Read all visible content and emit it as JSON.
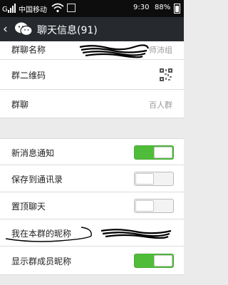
{
  "status_bar": {
    "carrier": "中国移动",
    "time": "9:30",
    "battery": "88%"
  },
  "header": {
    "title": "聊天信息(91)"
  },
  "settings": {
    "group_name": {
      "label": "群聊名称",
      "value": "师沛组"
    },
    "qr_code": {
      "label": "群二维码"
    },
    "group_chat": {
      "label": "群聊",
      "value": "百人群"
    },
    "new_msg_notify": {
      "label": "新消息通知",
      "on": true
    },
    "save_contacts": {
      "label": "保存到通讯录",
      "on": false
    },
    "pin_chat": {
      "label": "置顶聊天",
      "on": false
    },
    "my_nickname": {
      "label": "我在本群的昵称"
    },
    "show_member_nicknames": {
      "label": "显示群成员昵称",
      "on": true
    }
  }
}
